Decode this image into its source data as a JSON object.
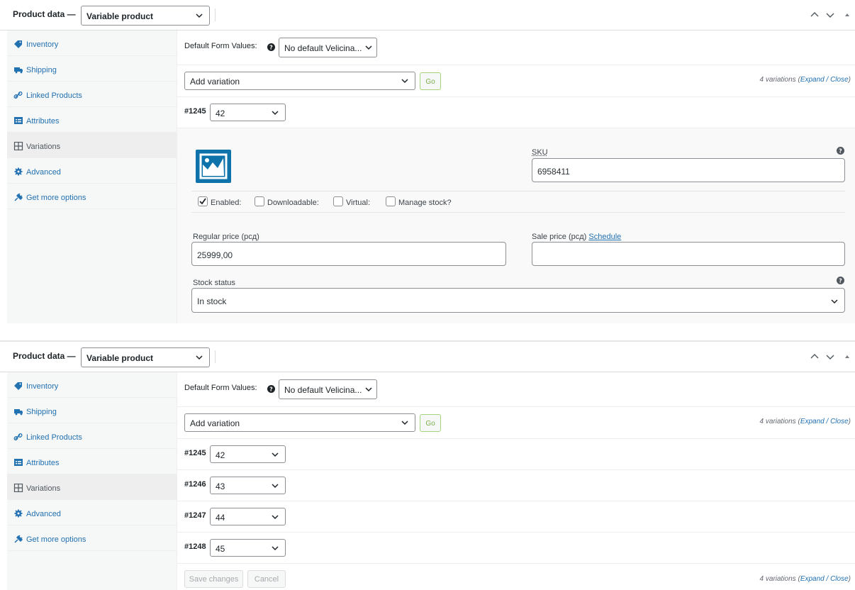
{
  "panel1": {
    "header": {
      "title": "Product data —",
      "product_type": "Variable product"
    },
    "sidebar": [
      {
        "label": "Inventory",
        "icon": "tag-icon"
      },
      {
        "label": "Shipping",
        "icon": "truck-icon"
      },
      {
        "label": "Linked Products",
        "icon": "link-icon"
      },
      {
        "label": "Attributes",
        "icon": "list-icon"
      },
      {
        "label": "Variations",
        "icon": "grid-icon",
        "active": true
      },
      {
        "label": "Advanced",
        "icon": "gear-icon"
      },
      {
        "label": "Get more options",
        "icon": "plugin-icon"
      }
    ],
    "default_form_values": {
      "label": "Default Form Values:",
      "value": "No default Velicina..."
    },
    "add_variation": {
      "value": "Add variation",
      "go_label": "Go"
    },
    "variations_count": {
      "count_text": "4 variations",
      "open_paren": "(",
      "expand": "Expand",
      "sep": " / ",
      "close": "Close",
      "close_paren": ")"
    },
    "variation": {
      "id": "#1245",
      "size": "42"
    },
    "detail": {
      "sku_label": "SKU",
      "sku_value": "6958411",
      "enabled_label": "Enabled:",
      "enabled_checked": true,
      "downloadable_label": "Downloadable:",
      "virtual_label": "Virtual:",
      "manage_stock_label": "Manage stock?",
      "regular_price_label": "Regular price (рсд)",
      "regular_price_value": "25999,00",
      "sale_price_label": "Sale price (рсд)",
      "schedule_label": "Schedule",
      "stock_status_label": "Stock status",
      "stock_status_value": "In stock"
    }
  },
  "panel2": {
    "header": {
      "title": "Product data —",
      "product_type": "Variable product"
    },
    "sidebar": [
      {
        "label": "Inventory",
        "icon": "tag-icon"
      },
      {
        "label": "Shipping",
        "icon": "truck-icon"
      },
      {
        "label": "Linked Products",
        "icon": "link-icon"
      },
      {
        "label": "Attributes",
        "icon": "list-icon"
      },
      {
        "label": "Variations",
        "icon": "grid-icon",
        "active": true
      },
      {
        "label": "Advanced",
        "icon": "gear-icon"
      },
      {
        "label": "Get more options",
        "icon": "plugin-icon"
      }
    ],
    "default_form_values": {
      "label": "Default Form Values:",
      "value": "No default Velicina..."
    },
    "add_variation": {
      "value": "Add variation",
      "go_label": "Go"
    },
    "variations_count": {
      "count_text": "4 variations",
      "open_paren": "(",
      "expand": "Expand",
      "sep": " / ",
      "close": "Close",
      "close_paren": ")"
    },
    "variations": [
      {
        "id": "#1245",
        "size": "42"
      },
      {
        "id": "#1246",
        "size": "43"
      },
      {
        "id": "#1247",
        "size": "44"
      },
      {
        "id": "#1248",
        "size": "45"
      }
    ],
    "footer": {
      "save_label": "Save changes",
      "cancel_label": "Cancel"
    }
  },
  "colors": {
    "link": "#2271b1",
    "sidebar_bg": "#f6f7f7",
    "image_placeholder": "#0e73aa",
    "go_border": "#a6d47b"
  }
}
